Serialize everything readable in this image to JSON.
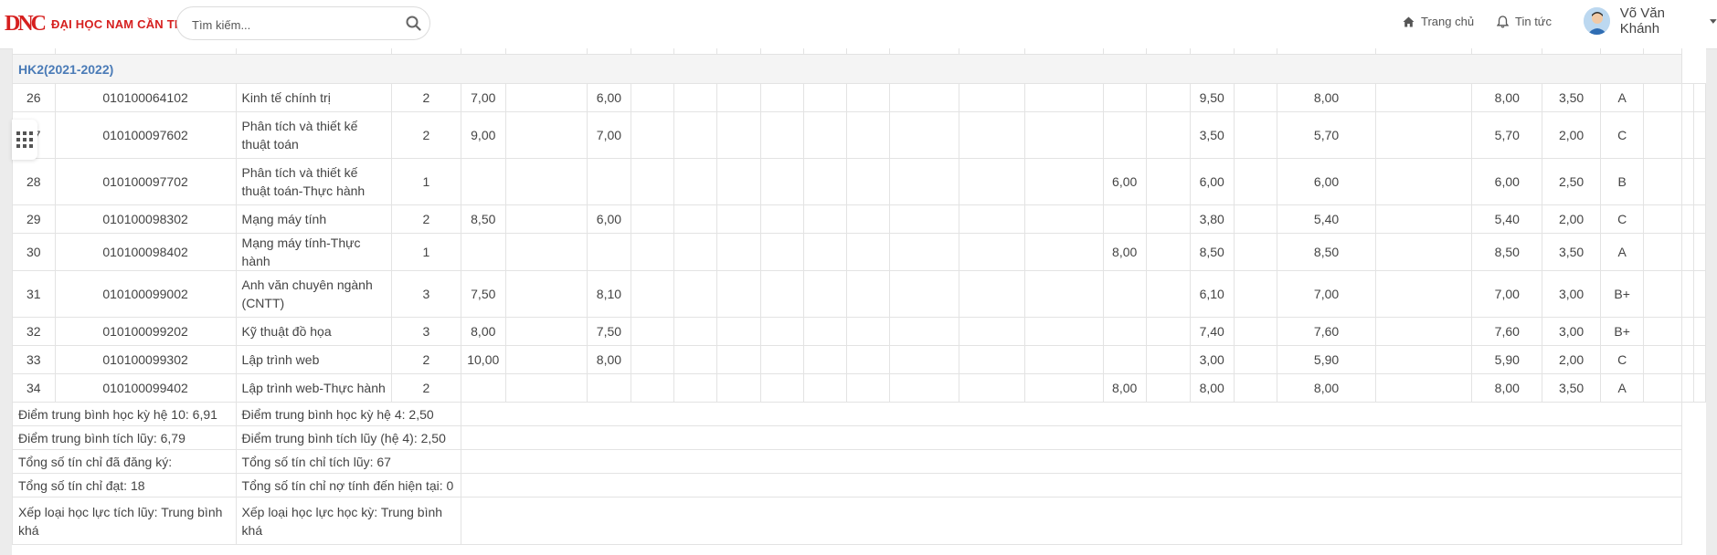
{
  "navbar": {
    "logo_mark": "DNC",
    "logo_text": "ĐẠI HỌC NAM CẦN THƠ",
    "search_placeholder": "Tìm kiếm...",
    "home_label": "Trang chủ",
    "news_label": "Tin tức",
    "user_name": "Võ Văn Khánh"
  },
  "semester_title": "HK2(2021-2022)",
  "rows": [
    {
      "stt": "26",
      "code": "010100064102",
      "name": "Kinh tế chính trị",
      "credits": "2",
      "c5": "7,00",
      "c7": "6,00",
      "c17": "",
      "c19": "9,50",
      "c21": "8,00",
      "c23": "8,00",
      "c24": "3,50",
      "c25": "A",
      "red": false
    },
    {
      "stt": "27",
      "code": "010100097602",
      "name": "Phân tích và thiết kế thuật toán",
      "credits": "2",
      "c5": "9,00",
      "c7": "7,00",
      "c17": "",
      "c19": "3,50",
      "c21": "5,70",
      "c23": "5,70",
      "c24": "2,00",
      "c25": "C",
      "red": true
    },
    {
      "stt": "28",
      "code": "010100097702",
      "name": "Phân tích và thiết kế thuật toán-Thực hành",
      "credits": "1",
      "c5": "",
      "c7": "",
      "c17": "6,00",
      "c19": "6,00",
      "c21": "6,00",
      "c23": "6,00",
      "c24": "2,50",
      "c25": "B",
      "red": false
    },
    {
      "stt": "29",
      "code": "010100098302",
      "name": "Mạng máy tính",
      "credits": "2",
      "c5": "8,50",
      "c7": "6,00",
      "c17": "",
      "c19": "3,80",
      "c21": "5,40",
      "c23": "5,40",
      "c24": "2,00",
      "c25": "C",
      "red": true
    },
    {
      "stt": "30",
      "code": "010100098402",
      "name": "Mạng máy tính-Thực hành",
      "credits": "1",
      "c5": "",
      "c7": "",
      "c17": "8,00",
      "c19": "8,50",
      "c21": "8,50",
      "c23": "8,50",
      "c24": "3,50",
      "c25": "A",
      "red": false
    },
    {
      "stt": "31",
      "code": "010100099002",
      "name": "Anh văn chuyên ngành (CNTT)",
      "credits": "3",
      "c5": "7,50",
      "c7": "8,10",
      "c17": "",
      "c19": "6,10",
      "c21": "7,00",
      "c23": "7,00",
      "c24": "3,00",
      "c25": "B+",
      "red": false
    },
    {
      "stt": "32",
      "code": "010100099202",
      "name": "Kỹ thuật đồ họa",
      "credits": "3",
      "c5": "8,00",
      "c7": "7,50",
      "c17": "",
      "c19": "7,40",
      "c21": "7,60",
      "c23": "7,60",
      "c24": "3,00",
      "c25": "B+",
      "red": false
    },
    {
      "stt": "33",
      "code": "010100099302",
      "name": "Lập trình web",
      "credits": "2",
      "c5": "10,00",
      "c7": "8,00",
      "c17": "",
      "c19": "3,00",
      "c21": "5,90",
      "c23": "5,90",
      "c24": "2,00",
      "c25": "C",
      "red": true
    },
    {
      "stt": "34",
      "code": "010100099402",
      "name": "Lập trình web-Thực hành",
      "credits": "2",
      "c5": "",
      "c7": "",
      "c17": "8,00",
      "c19": "8,00",
      "c21": "8,00",
      "c23": "8,00",
      "c24": "3,50",
      "c25": "A",
      "red": false
    }
  ],
  "summary": [
    {
      "left": "Điểm trung bình học kỳ hệ 10: 6,91",
      "right": "Điểm trung bình học kỳ hệ 4: 2,50"
    },
    {
      "left": "Điểm trung bình tích lũy: 6,79",
      "right": "Điểm trung bình tích lũy (hệ 4): 2,50"
    },
    {
      "left": "Tổng số tín chỉ đã đăng ký:",
      "right": "Tổng số tín chỉ tích lũy: 67"
    },
    {
      "left": "Tổng số tín chỉ đạt: 18",
      "right": "Tổng số tín chỉ nợ tính đến hiện tại: 0"
    },
    {
      "left": "Xếp loại học lực tích lũy: Trung bình khá",
      "right": "Xếp loại học lực học kỳ: Trung bình khá"
    }
  ],
  "colors": {
    "accent": "#4a7bb7",
    "failing": "#e03030",
    "brand": "#d6201f"
  }
}
